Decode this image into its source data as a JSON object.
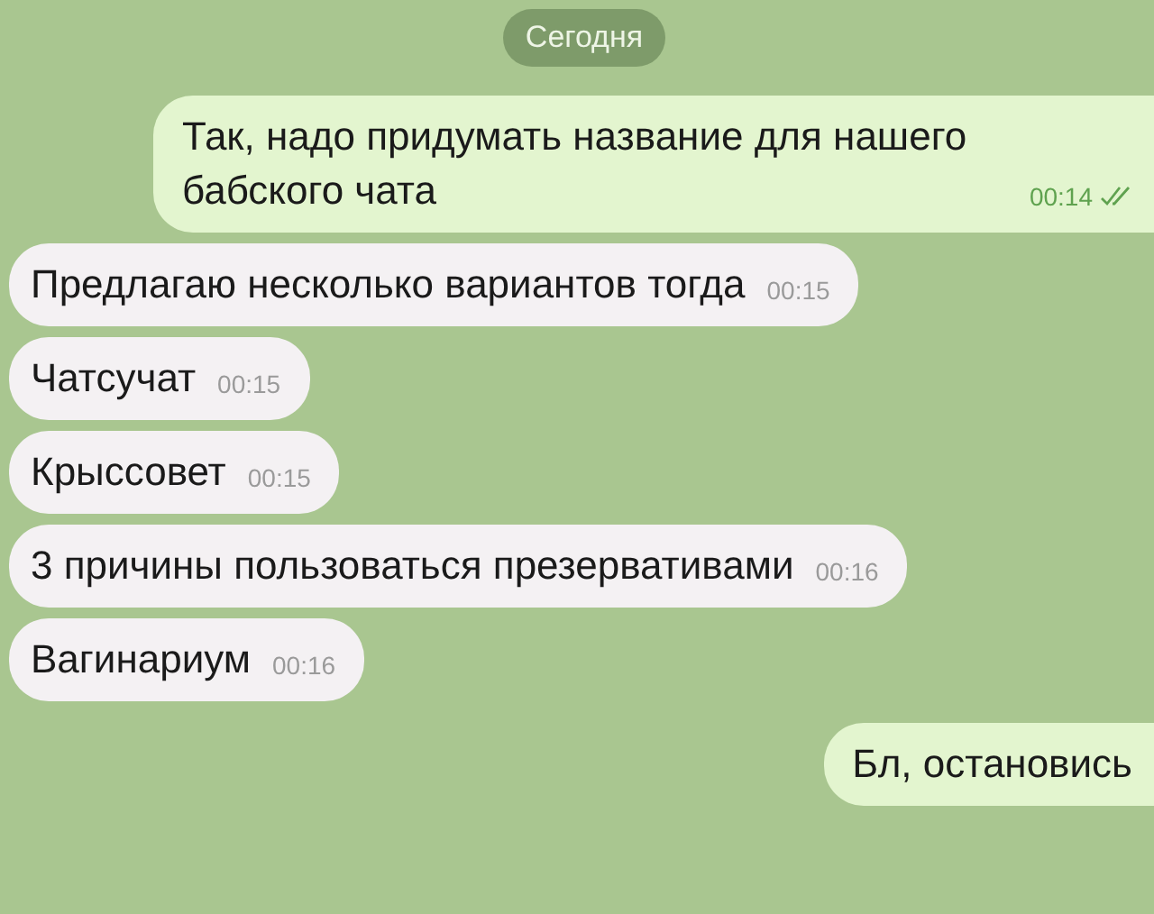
{
  "date_badge": "Сегодня",
  "messages": [
    {
      "kind": "outgoing",
      "text": "Так, надо придумать название для нашего бабского чата",
      "time": "00:14",
      "read": true
    },
    {
      "kind": "incoming",
      "text": "Предлагаю несколько вариантов тогда",
      "time": "00:15"
    },
    {
      "kind": "incoming",
      "text": "Чатсучат",
      "time": "00:15"
    },
    {
      "kind": "incoming",
      "text": "Крыссовет",
      "time": "00:15"
    },
    {
      "kind": "incoming",
      "text": "3 причины пользоваться презервативами",
      "time": "00:16"
    },
    {
      "kind": "incoming",
      "text": "Вагинариум",
      "time": "00:16"
    },
    {
      "kind": "outgoing",
      "text": "Бл, остановись"
    }
  ]
}
